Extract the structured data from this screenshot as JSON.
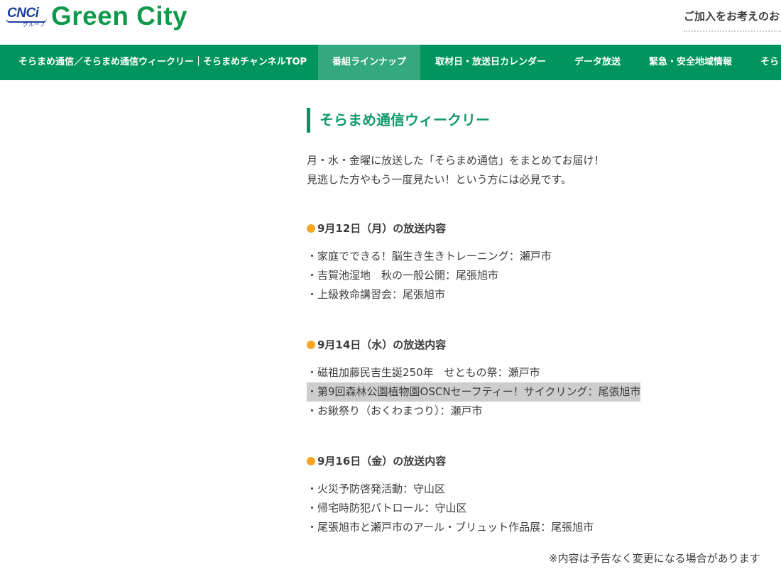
{
  "header": {
    "logo_mark": "CNCi",
    "logo_sub": "グループ",
    "brand": "Green City",
    "join_text": "ご加入をお考えのお"
  },
  "nav": {
    "items": [
      {
        "label": "そらまめ通信／そらまめ通信ウィークリー｜そらまめチャンネルTOP",
        "active": false
      },
      {
        "label": "番組ラインナップ",
        "active": true
      },
      {
        "label": "取材日・放送日カレンダー",
        "active": false
      },
      {
        "label": "データ放送",
        "active": false
      },
      {
        "label": "緊急・安全地域情報",
        "active": false
      },
      {
        "label": "そら",
        "active": false
      }
    ]
  },
  "main": {
    "title": "そらまめ通信ウィークリー",
    "intro": [
      "月・水・金曜に放送した「そらまめ通信」をまとめてお届け！",
      "見逃した方やもう一度見たい！という方には必見です。"
    ],
    "sections": [
      {
        "title": "9月12日（月）の放送内容",
        "items": [
          {
            "text": "・家庭でできる！脳生き生きトレーニング：瀬戸市",
            "highlight": false
          },
          {
            "text": "・吉賀池湿地　秋の一般公開：尾張旭市",
            "highlight": false
          },
          {
            "text": "・上級救命講習会：尾張旭市",
            "highlight": false
          }
        ]
      },
      {
        "title": "9月14日（水）の放送内容",
        "items": [
          {
            "text": "・磁祖加藤民吉生誕250年　せともの祭：瀬戸市",
            "highlight": false
          },
          {
            "text": "・第9回森林公園植物園OSCNセーフティー！サイクリング：尾張旭市",
            "highlight": true
          },
          {
            "text": "・お鍬祭り（おくわまつり）：瀬戸市",
            "highlight": false
          }
        ]
      },
      {
        "title": "9月16日（金）の放送内容",
        "items": [
          {
            "text": "・火災予防啓発活動：守山区",
            "highlight": false
          },
          {
            "text": "・帰宅時防犯パトロール：守山区",
            "highlight": false
          },
          {
            "text": "・尾張旭市と瀬戸市のアール・ブリュット作品展：尾張旭市",
            "highlight": false
          }
        ]
      }
    ],
    "note": "※内容は予告なく変更になる場合があります"
  },
  "colors": {
    "brand_green": "#0f9a4b",
    "nav_green": "#00955f",
    "nav_active": "#33a97d",
    "heading_green": "#0f9a6a",
    "bullet_orange": "#f6a623",
    "highlight_gray": "#cdcdcd",
    "logo_blue": "#1b3e9a"
  }
}
